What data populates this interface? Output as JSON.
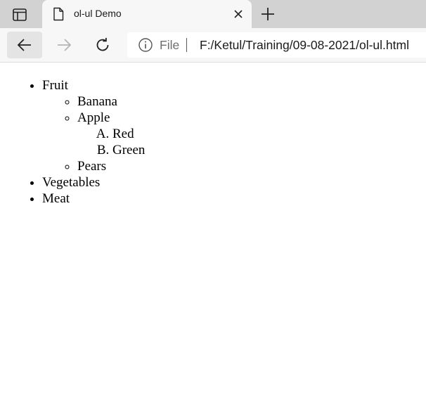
{
  "browser": {
    "tab": {
      "title": "ol-ul Demo"
    },
    "address": {
      "scheme_label": "File",
      "url": "F:/Ketul/Training/09-08-2021/ol-ul.html"
    }
  },
  "page": {
    "items": [
      {
        "label": "Fruit"
      },
      {
        "label": "Banana"
      },
      {
        "label": "Apple"
      },
      {
        "label": "Red"
      },
      {
        "label": "Green"
      },
      {
        "label": "Pears"
      },
      {
        "label": "Vegetables"
      },
      {
        "label": "Meat"
      }
    ]
  }
}
